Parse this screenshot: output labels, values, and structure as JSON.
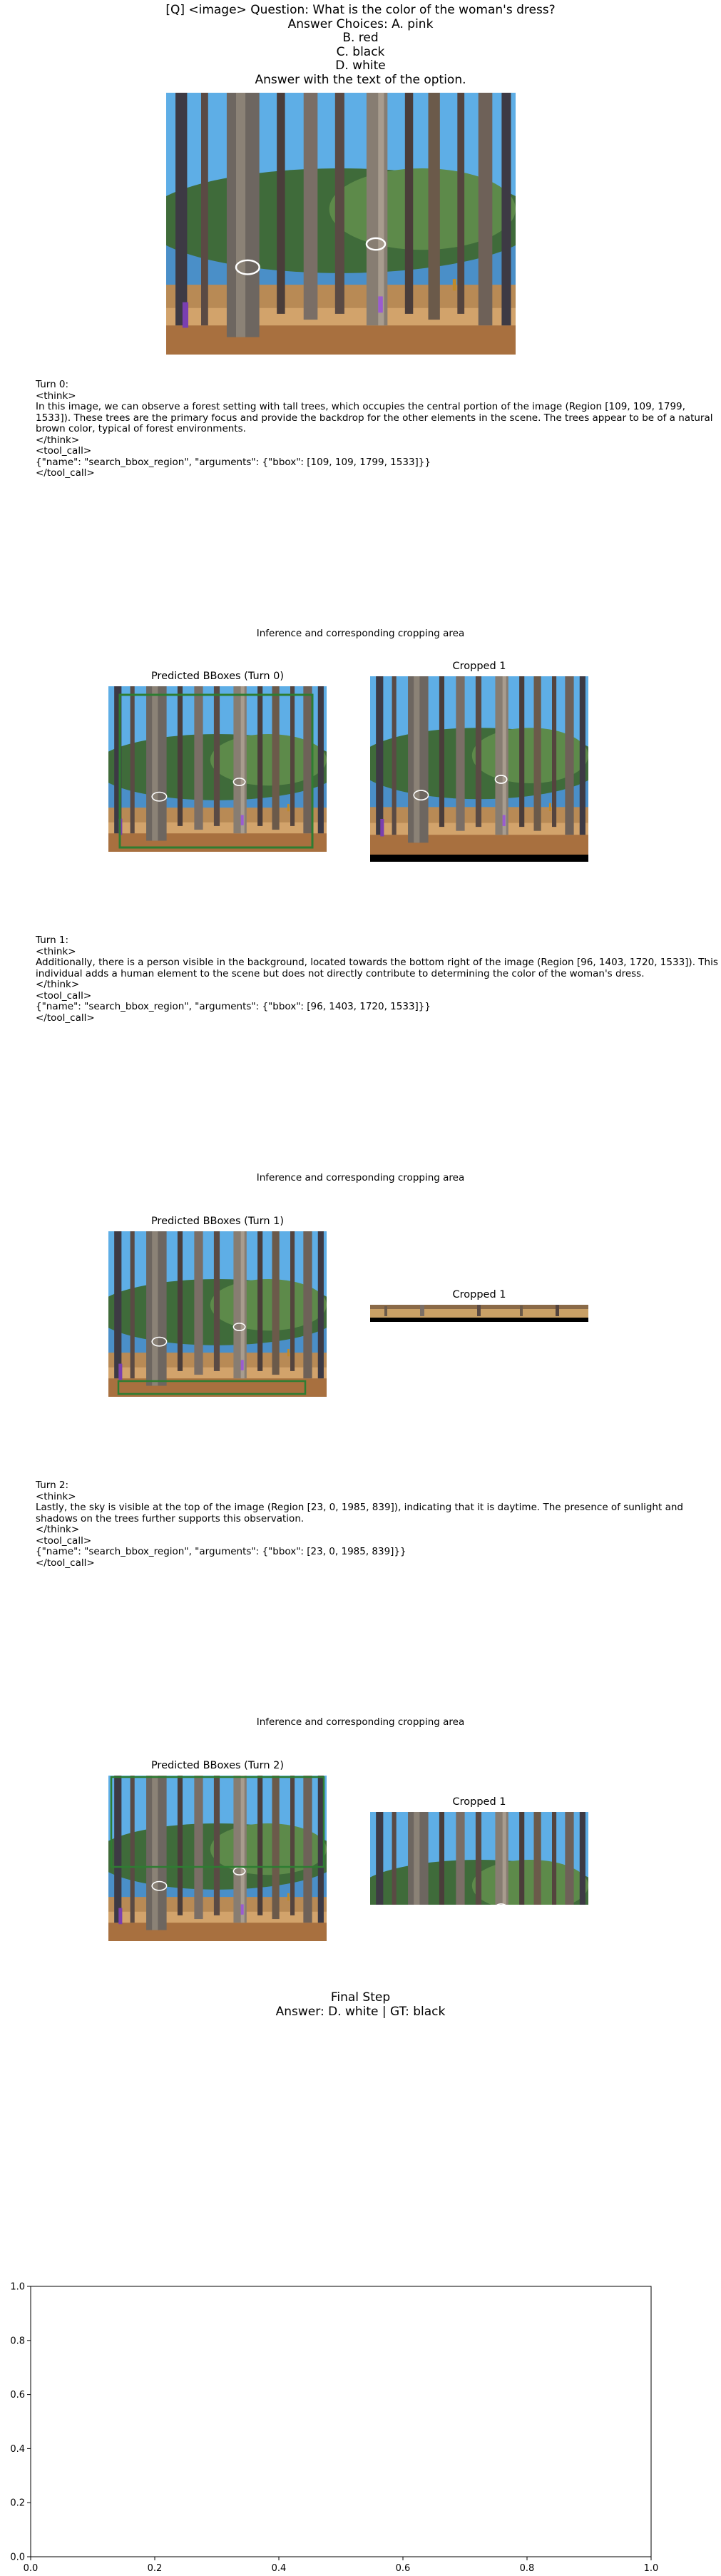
{
  "question": {
    "lines": [
      "[Q] <image> Question: What is the color of the woman's dress?",
      "Answer Choices: A. pink",
      "B. red",
      "C. black",
      "D. white",
      "Answer with the text of the option."
    ]
  },
  "turns": [
    {
      "text": "Turn 0:\n<think>\nIn this image, we can observe a forest setting with tall trees, which occupies the central portion of the image (Region [109, 109, 1799, 1533]). These trees are the primary focus and provide the backdrop for the other elements in the scene. The trees appear to be of a natural brown color, typical of forest environments.\n</think>\n<tool_call>\n{\"name\": \"search_bbox_region\", \"arguments\": {\"bbox\": [109, 109, 1799, 1533]}}\n</tool_call>",
      "section_caption": "Inference and corresponding cropping area",
      "pred_title": "Predicted BBoxes (Turn 0)",
      "crop_title": "Cropped 1"
    },
    {
      "text": "Turn 1:\n<think>\nAdditionally, there is a person visible in the background, located towards the bottom right of the image (Region [96, 1403, 1720, 1533]). This individual adds a human element to the scene but does not directly contribute to determining the color of the woman's dress.\n</think>\n<tool_call>\n{\"name\": \"search_bbox_region\", \"arguments\": {\"bbox\": [96, 1403, 1720, 1533]}}\n</tool_call>",
      "section_caption": "Inference and corresponding cropping area",
      "pred_title": "Predicted BBoxes (Turn 1)",
      "crop_title": "Cropped 1"
    },
    {
      "text": "Turn 2:\n<think>\nLastly, the sky is visible at the top of the image (Region [23, 0, 1985, 839]), indicating that it is daytime. The presence of sunlight and shadows on the trees further supports this observation.\n</think>\n<tool_call>\n{\"name\": \"search_bbox_region\", \"arguments\": {\"bbox\": [23, 0, 1985, 839]}}\n</tool_call>",
      "section_caption": "Inference and corresponding cropping area",
      "pred_title": "Predicted BBoxes (Turn 2)",
      "crop_title": "Cropped 1"
    }
  ],
  "final": {
    "title": "Final Step",
    "answer": "Answer: D. white | GT: black"
  },
  "colors": {
    "bbox_green": "#2e7d32",
    "bbox_blue": "#1f5fa8",
    "sky": "#4fa3e0",
    "trunk": "#6b5a4a",
    "ground": "#c9a066"
  },
  "chart_data": {
    "type": "scatter",
    "title": "",
    "xlabel": "",
    "ylabel": "",
    "xlim": [
      0,
      1
    ],
    "ylim": [
      0,
      1
    ],
    "xticks": [
      "0.0",
      "0.2",
      "0.4",
      "0.6",
      "0.8",
      "1.0"
    ],
    "yticks": [
      "0.0",
      "0.2",
      "0.4",
      "0.6",
      "0.8",
      "1.0"
    ],
    "series": []
  }
}
